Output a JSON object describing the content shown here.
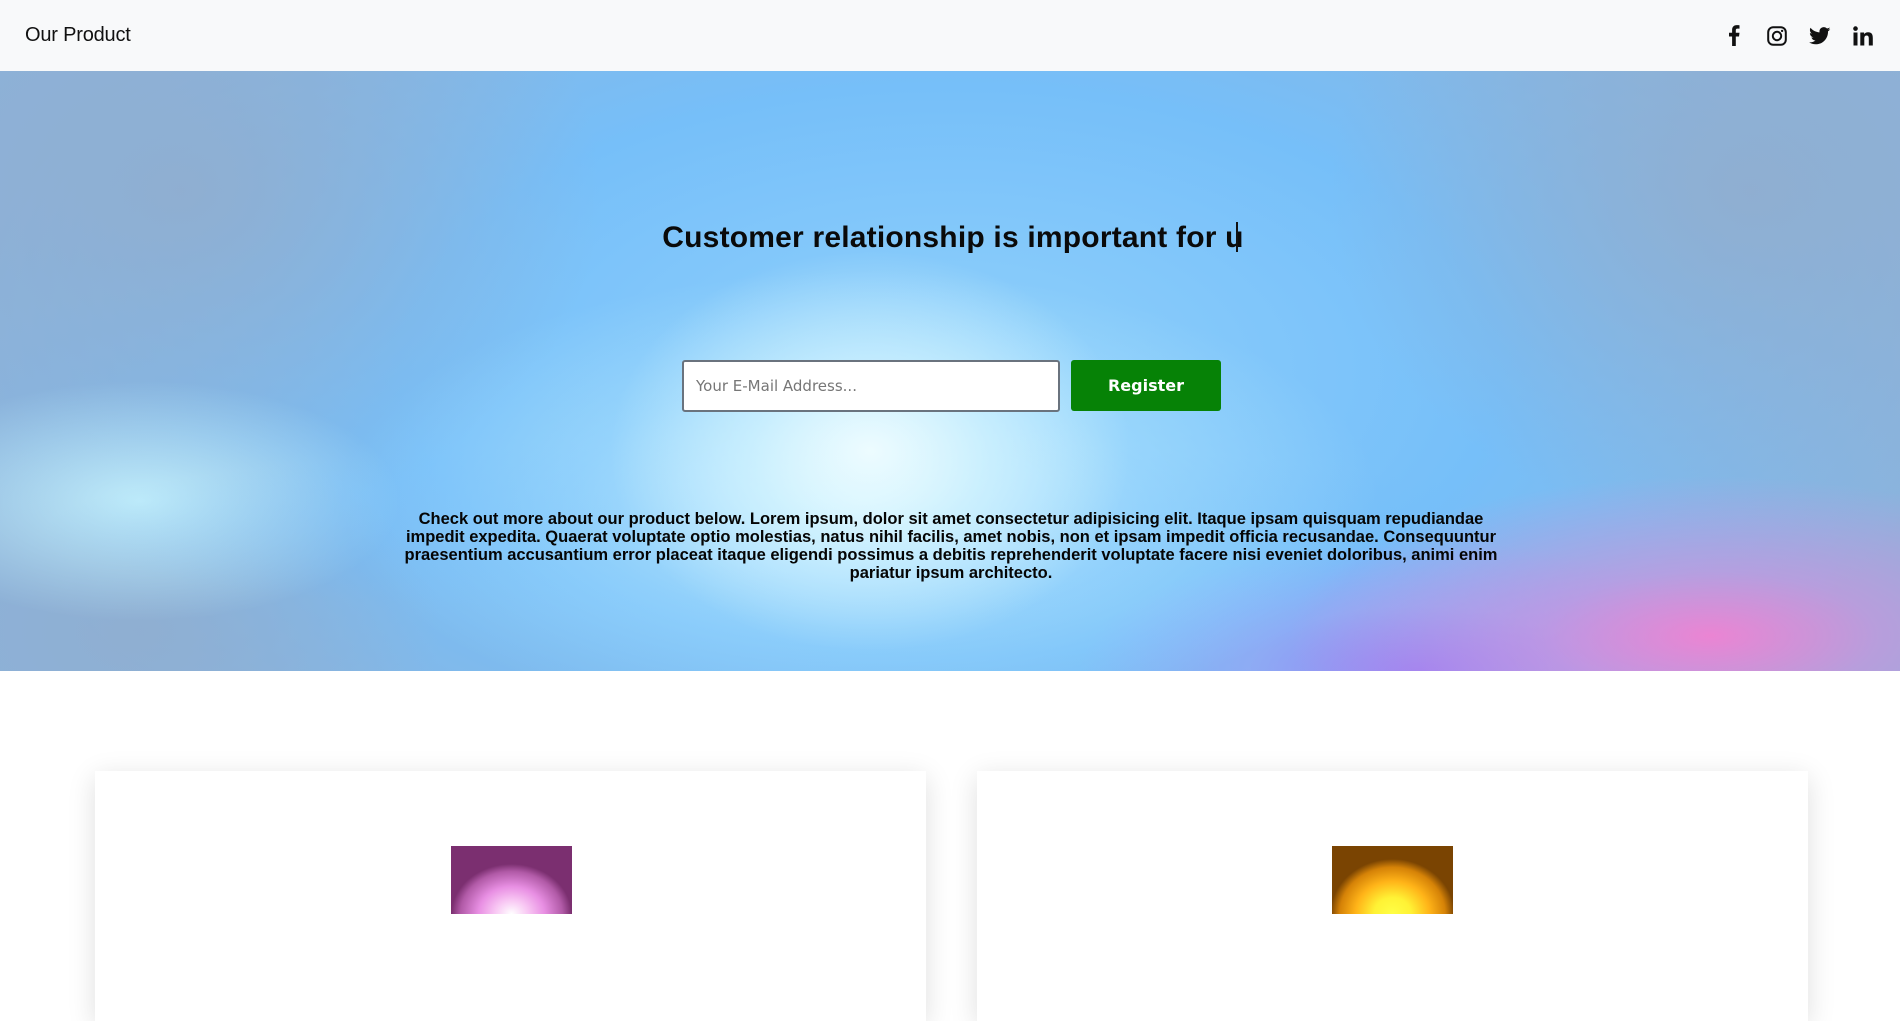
{
  "navbar": {
    "brand": "Our Product",
    "social_icons": [
      "facebook-icon",
      "instagram-icon",
      "twitter-icon",
      "linkedin-icon"
    ]
  },
  "hero": {
    "title": "Customer relationship is important for u",
    "email_placeholder": "Your E-Mail Address...",
    "register_label": "Register",
    "description": "Check out more about our product below. Lorem ipsum, dolor sit amet consectetur adipisicing elit. Itaque ipsam quisquam repudiandae impedit expedita. Quaerat voluptate optio molestias, natus nihil facilis, amet nobis, non et ipsam impedit officia recusandae. Consequuntur praesentium accusantium error placeat itaque eligendi possimus a debitis reprehenderit voluptate facere nisi eveniet doloribus, animi enim pariatur ipsum architecto."
  },
  "cards": [
    {
      "image_colors": [
        "#ffffff",
        "#e88fe3",
        "#7b2f70"
      ]
    },
    {
      "image_colors": [
        "#ffff45",
        "#ffb318",
        "#7a4402"
      ]
    }
  ],
  "colors": {
    "register_button": "#068206",
    "navbar_background": "#f8f9fa"
  }
}
